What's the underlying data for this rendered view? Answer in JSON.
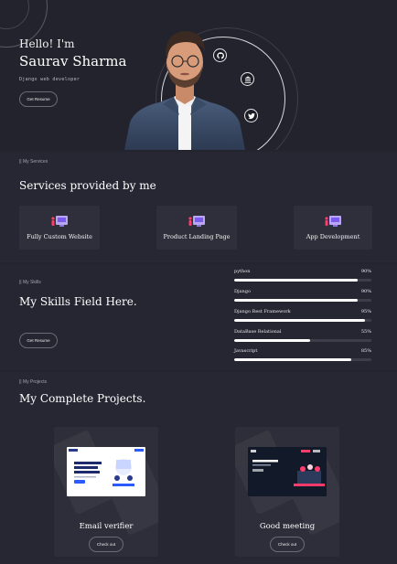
{
  "hero": {
    "greeting": "Hello! I'm",
    "name": "Saurav Sharma",
    "role": "Django web developer",
    "resume_button": "Get Resume",
    "social_icons": [
      "github-icon",
      "bank-icon",
      "twitter-icon"
    ]
  },
  "services": {
    "breadcrumb": "|| My Services",
    "title": "Services provided by me",
    "items": [
      {
        "label": "Fully Custom Website",
        "icon": "web-design-icon"
      },
      {
        "label": "Product Landing Page",
        "icon": "web-design-icon"
      },
      {
        "label": "App Development",
        "icon": "web-design-icon"
      }
    ]
  },
  "skills": {
    "breadcrumb": "|| My Skills",
    "title": "My Skills Field Here.",
    "resume_button": "Get Resume",
    "items": [
      {
        "name": "python",
        "percent_label": "90%",
        "level": 0.9
      },
      {
        "name": "Django",
        "percent_label": "90%",
        "level": 0.9
      },
      {
        "name": "Django Rest Framework",
        "percent_label": "95%",
        "level": 0.95
      },
      {
        "name": "DataBase Relational",
        "percent_label": "55%",
        "level": 0.55
      },
      {
        "name": "Javascript",
        "percent_label": "85%",
        "level": 0.85
      }
    ]
  },
  "projects": {
    "breadcrumb": "|| My Projects",
    "title": "My Complete Projects.",
    "items": [
      {
        "title": "Email verifier",
        "button": "Check out"
      },
      {
        "title": "Good meeting",
        "button": "Check out"
      }
    ]
  },
  "colors": {
    "background": "#24242f",
    "card": "#2f2f3c",
    "accent": "#ff3b6b",
    "text": "#ffffff"
  }
}
